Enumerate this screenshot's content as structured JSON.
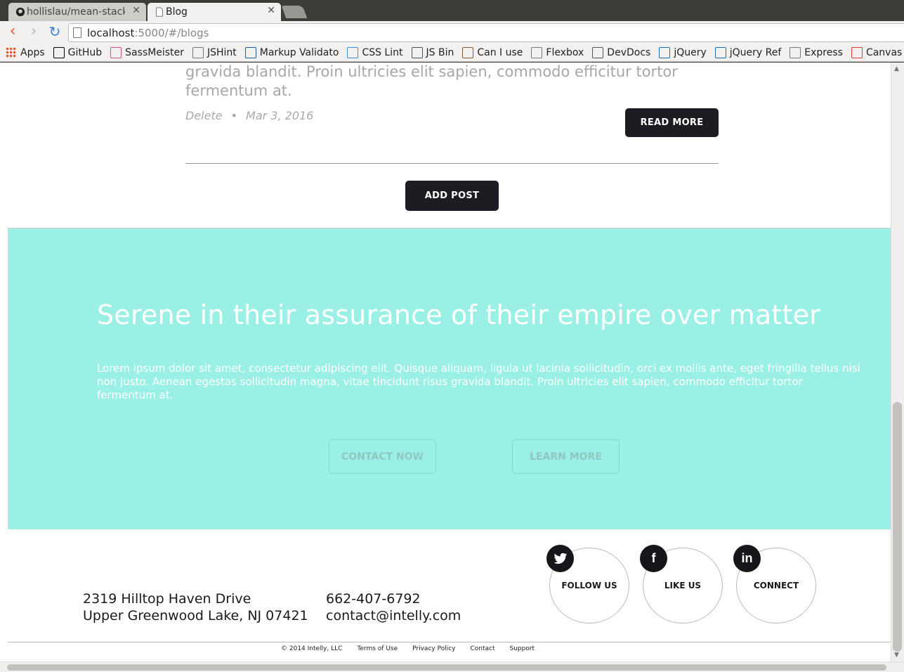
{
  "browser": {
    "tabs": [
      {
        "title": "hollislau/mean-stack",
        "active": false
      },
      {
        "title": "Blog",
        "active": true
      }
    ],
    "url_host": "localhost",
    "url_rest": ":5000/#/blogs",
    "bookmarks": [
      {
        "label": "Apps",
        "icon": "apps-grid-icon",
        "color": "#e0572b"
      },
      {
        "label": "GitHub",
        "icon": "github-icon",
        "color": "#000000"
      },
      {
        "label": "SassMeister",
        "icon": "sassmeister-icon",
        "color": "#c6538c"
      },
      {
        "label": "JSHint",
        "icon": "page-icon",
        "color": "#777777"
      },
      {
        "label": "Markup Validato",
        "icon": "w3c-icon",
        "color": "#1a5c9e"
      },
      {
        "label": "CSS Lint",
        "icon": "csslint-icon",
        "color": "#3a8ed6"
      },
      {
        "label": "JS Bin",
        "icon": "jsbin-icon",
        "color": "#445566"
      },
      {
        "label": "Can I use",
        "icon": "caniuse-icon",
        "color": "#8a5a2b"
      },
      {
        "label": "Flexbox",
        "icon": "page-icon",
        "color": "#777777"
      },
      {
        "label": "DevDocs",
        "icon": "devdocs-icon",
        "color": "#555555"
      },
      {
        "label": "jQuery",
        "icon": "jquery-icon",
        "color": "#1a6fb5"
      },
      {
        "label": "jQuery Ref",
        "icon": "jquery-icon",
        "color": "#1a6fb5"
      },
      {
        "label": "Express",
        "icon": "page-icon",
        "color": "#777777"
      },
      {
        "label": "Canvas",
        "icon": "canvas-icon",
        "color": "#d93a2b"
      }
    ]
  },
  "post": {
    "excerpt_line1": "gravida blandit. Proin ultricies elit sapien, commodo efficitur tortor",
    "excerpt_line2": "fermentum at.",
    "delete_label": "Delete",
    "separator": "•",
    "date": "Mar 3, 2016",
    "read_more_label": "READ MORE"
  },
  "add_post_label": "ADD POST",
  "hero": {
    "title": "Serene in their assurance of their empire over matter",
    "text": "Lorem ipsum dolor sit amet, consectetur adipiscing elit. Quisque aliquam, ligula ut lacinia sollicitudin, orci ex mollis ante, eget fringilla tellus nisi non justo. Aenean egestas sollicitudin magna, vitae tincidunt risus gravida blandit. Proin ultricies elit sapien, commodo efficitur tortor fermentum at.",
    "contact_label": "CONTACT NOW",
    "learn_label": "LEARN MORE",
    "background": "#9af0e5"
  },
  "footer": {
    "address_line1": "2319 Hilltop Haven Drive",
    "address_line2": "Upper Greenwood Lake, NJ 07421",
    "phone": "662-407-6792",
    "email": "contact@intelly.com",
    "social": [
      {
        "label": "FOLLOW US",
        "icon": "twitter-icon",
        "glyph": "🐦"
      },
      {
        "label": "LIKE US",
        "icon": "facebook-icon",
        "glyph": "f"
      },
      {
        "label": "CONNECT",
        "icon": "linkedin-icon",
        "glyph": "in"
      }
    ],
    "links": [
      "© 2014 Intelly, LLC",
      "Terms of Use",
      "Privacy Policy",
      "Contact",
      "Support"
    ]
  }
}
